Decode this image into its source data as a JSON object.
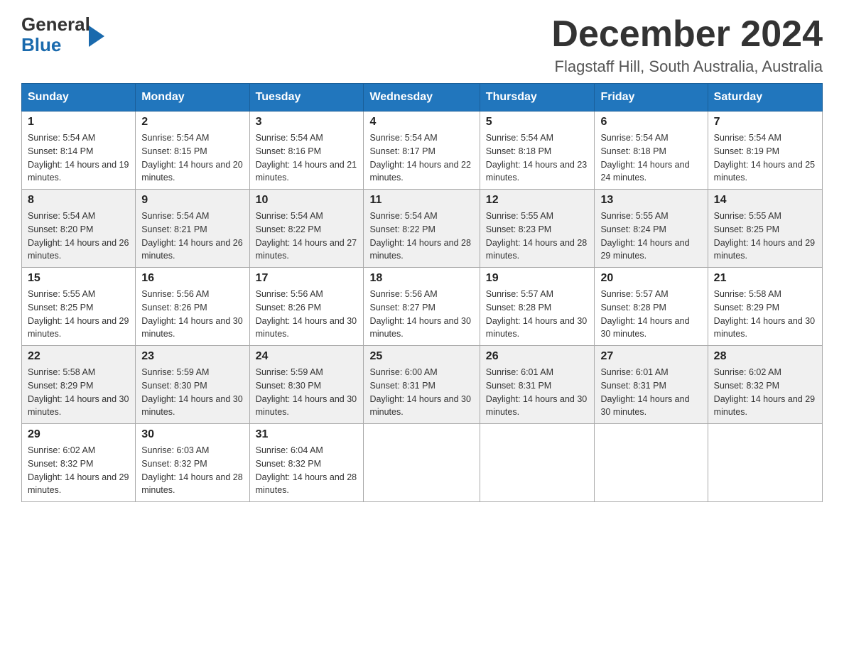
{
  "logo": {
    "general": "General",
    "blue": "Blue"
  },
  "header": {
    "month": "December 2024",
    "location": "Flagstaff Hill, South Australia, Australia"
  },
  "days_of_week": [
    "Sunday",
    "Monday",
    "Tuesday",
    "Wednesday",
    "Thursday",
    "Friday",
    "Saturday"
  ],
  "weeks": [
    [
      {
        "day": "1",
        "sunrise": "5:54 AM",
        "sunset": "8:14 PM",
        "daylight": "14 hours and 19 minutes."
      },
      {
        "day": "2",
        "sunrise": "5:54 AM",
        "sunset": "8:15 PM",
        "daylight": "14 hours and 20 minutes."
      },
      {
        "day": "3",
        "sunrise": "5:54 AM",
        "sunset": "8:16 PM",
        "daylight": "14 hours and 21 minutes."
      },
      {
        "day": "4",
        "sunrise": "5:54 AM",
        "sunset": "8:17 PM",
        "daylight": "14 hours and 22 minutes."
      },
      {
        "day": "5",
        "sunrise": "5:54 AM",
        "sunset": "8:18 PM",
        "daylight": "14 hours and 23 minutes."
      },
      {
        "day": "6",
        "sunrise": "5:54 AM",
        "sunset": "8:18 PM",
        "daylight": "14 hours and 24 minutes."
      },
      {
        "day": "7",
        "sunrise": "5:54 AM",
        "sunset": "8:19 PM",
        "daylight": "14 hours and 25 minutes."
      }
    ],
    [
      {
        "day": "8",
        "sunrise": "5:54 AM",
        "sunset": "8:20 PM",
        "daylight": "14 hours and 26 minutes."
      },
      {
        "day": "9",
        "sunrise": "5:54 AM",
        "sunset": "8:21 PM",
        "daylight": "14 hours and 26 minutes."
      },
      {
        "day": "10",
        "sunrise": "5:54 AM",
        "sunset": "8:22 PM",
        "daylight": "14 hours and 27 minutes."
      },
      {
        "day": "11",
        "sunrise": "5:54 AM",
        "sunset": "8:22 PM",
        "daylight": "14 hours and 28 minutes."
      },
      {
        "day": "12",
        "sunrise": "5:55 AM",
        "sunset": "8:23 PM",
        "daylight": "14 hours and 28 minutes."
      },
      {
        "day": "13",
        "sunrise": "5:55 AM",
        "sunset": "8:24 PM",
        "daylight": "14 hours and 29 minutes."
      },
      {
        "day": "14",
        "sunrise": "5:55 AM",
        "sunset": "8:25 PM",
        "daylight": "14 hours and 29 minutes."
      }
    ],
    [
      {
        "day": "15",
        "sunrise": "5:55 AM",
        "sunset": "8:25 PM",
        "daylight": "14 hours and 29 minutes."
      },
      {
        "day": "16",
        "sunrise": "5:56 AM",
        "sunset": "8:26 PM",
        "daylight": "14 hours and 30 minutes."
      },
      {
        "day": "17",
        "sunrise": "5:56 AM",
        "sunset": "8:26 PM",
        "daylight": "14 hours and 30 minutes."
      },
      {
        "day": "18",
        "sunrise": "5:56 AM",
        "sunset": "8:27 PM",
        "daylight": "14 hours and 30 minutes."
      },
      {
        "day": "19",
        "sunrise": "5:57 AM",
        "sunset": "8:28 PM",
        "daylight": "14 hours and 30 minutes."
      },
      {
        "day": "20",
        "sunrise": "5:57 AM",
        "sunset": "8:28 PM",
        "daylight": "14 hours and 30 minutes."
      },
      {
        "day": "21",
        "sunrise": "5:58 AM",
        "sunset": "8:29 PM",
        "daylight": "14 hours and 30 minutes."
      }
    ],
    [
      {
        "day": "22",
        "sunrise": "5:58 AM",
        "sunset": "8:29 PM",
        "daylight": "14 hours and 30 minutes."
      },
      {
        "day": "23",
        "sunrise": "5:59 AM",
        "sunset": "8:30 PM",
        "daylight": "14 hours and 30 minutes."
      },
      {
        "day": "24",
        "sunrise": "5:59 AM",
        "sunset": "8:30 PM",
        "daylight": "14 hours and 30 minutes."
      },
      {
        "day": "25",
        "sunrise": "6:00 AM",
        "sunset": "8:31 PM",
        "daylight": "14 hours and 30 minutes."
      },
      {
        "day": "26",
        "sunrise": "6:01 AM",
        "sunset": "8:31 PM",
        "daylight": "14 hours and 30 minutes."
      },
      {
        "day": "27",
        "sunrise": "6:01 AM",
        "sunset": "8:31 PM",
        "daylight": "14 hours and 30 minutes."
      },
      {
        "day": "28",
        "sunrise": "6:02 AM",
        "sunset": "8:32 PM",
        "daylight": "14 hours and 29 minutes."
      }
    ],
    [
      {
        "day": "29",
        "sunrise": "6:02 AM",
        "sunset": "8:32 PM",
        "daylight": "14 hours and 29 minutes."
      },
      {
        "day": "30",
        "sunrise": "6:03 AM",
        "sunset": "8:32 PM",
        "daylight": "14 hours and 28 minutes."
      },
      {
        "day": "31",
        "sunrise": "6:04 AM",
        "sunset": "8:32 PM",
        "daylight": "14 hours and 28 minutes."
      },
      null,
      null,
      null,
      null
    ]
  ],
  "labels": {
    "sunrise": "Sunrise:",
    "sunset": "Sunset:",
    "daylight": "Daylight:"
  }
}
